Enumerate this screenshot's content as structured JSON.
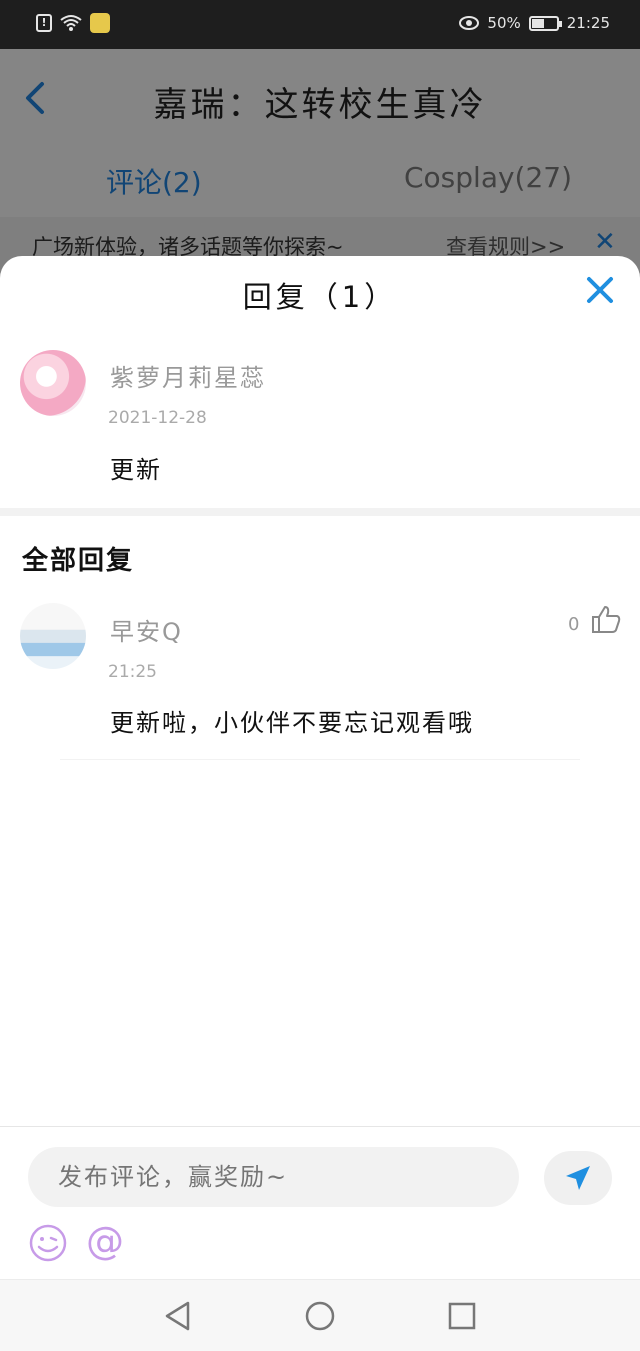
{
  "status_bar": {
    "alert_icon": "alert-icon",
    "battery_percent": "50%",
    "battery_level": 0.5,
    "time": "21:25"
  },
  "page": {
    "title": "嘉瑞：这转校生真冷",
    "tabs": [
      {
        "label": "评论(2)",
        "active": true
      },
      {
        "label": "Cosplay(27)",
        "active": false
      }
    ],
    "notice_text": "广场新体验，诸多话题等你探索~",
    "notice_link": "查看规则>>"
  },
  "sheet": {
    "title": "回复（1）",
    "main_comment": {
      "user": "紫萝月莉星蕊",
      "date": "2021-12-28",
      "text": "更新"
    },
    "section_title": "全部回复",
    "replies": [
      {
        "user": "早安Q",
        "time": "21:25",
        "text": "更新啦，小伙伴不要忘记观看哦",
        "likes": "0"
      }
    ]
  },
  "composer": {
    "placeholder": "发布评论，赢奖励~",
    "at_symbol": "@"
  },
  "colors": {
    "accent": "#1f7fd6",
    "close": "#1f8fe0",
    "emoji": "#c79be8"
  }
}
